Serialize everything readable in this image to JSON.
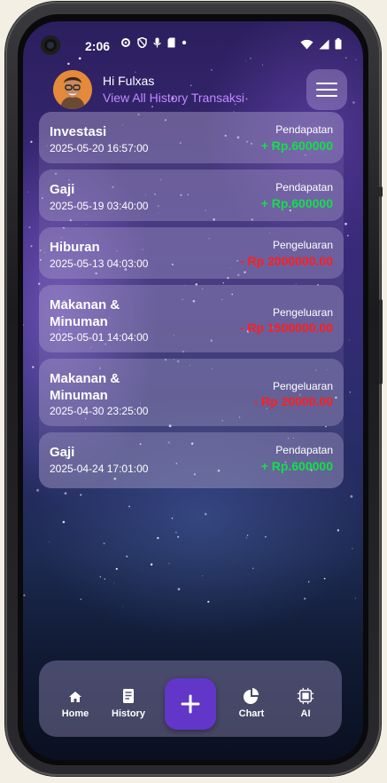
{
  "status_bar": {
    "time": "2:06"
  },
  "header": {
    "greeting": "Hi Fulxas",
    "subtitle": "View All History Transaksi"
  },
  "transactions": [
    {
      "category": "Investasi",
      "datetime": "2025-05-20 16:57:00",
      "type": "Pendapatan",
      "amount": "+ Rp.600000",
      "color": "#12e04a"
    },
    {
      "category": "Gaji",
      "datetime": "2025-05-19 03:40:00",
      "type": "Pendapatan",
      "amount": "+ Rp.600000",
      "color": "#12e04a"
    },
    {
      "category": "Hiburan",
      "datetime": "2025-05-13 04:03:00",
      "type": "Pengeluaran",
      "amount": "- Rp 2000000.00",
      "color": "#ff1e1e"
    },
    {
      "category": "Makanan & Minuman",
      "datetime": "2025-05-01 14:04:00",
      "type": "Pengeluaran",
      "amount": "- Rp 1500000.00",
      "color": "#ff1e1e"
    },
    {
      "category": "Makanan & Minuman",
      "datetime": "2025-04-30 23:25:00",
      "type": "Pengeluaran",
      "amount": "- Rp 20000.00",
      "color": "#ff1e1e"
    },
    {
      "category": "Gaji",
      "datetime": "2025-04-24 17:01:00",
      "type": "Pendapatan",
      "amount": "+ Rp.600000",
      "color": "#12e04a"
    }
  ],
  "nav": {
    "home": "Home",
    "history": "History",
    "chart": "Chart",
    "ai": "AI",
    "add_icon": "plus-icon"
  },
  "colors": {
    "income": "#12e04a",
    "expense": "#ff1e1e",
    "accent": "#6236c8",
    "link": "#c08cff"
  }
}
